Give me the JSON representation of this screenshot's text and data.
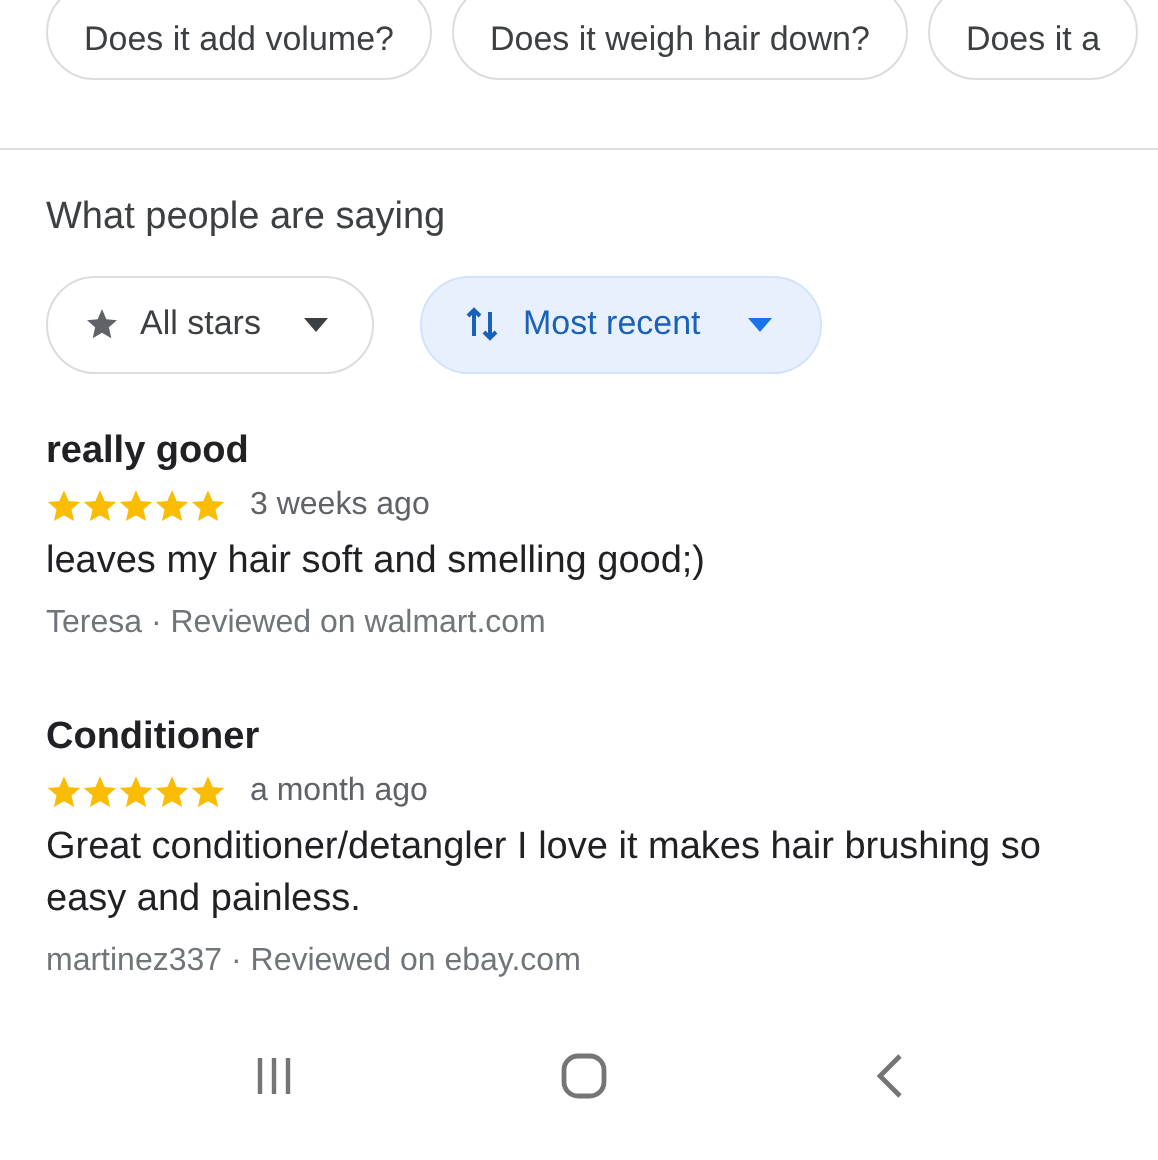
{
  "question_chips": [
    {
      "label": "Does it add volume?"
    },
    {
      "label": "Does it weigh hair down?"
    },
    {
      "label": "Does it a"
    }
  ],
  "reviews_section": {
    "heading": "What people are saying",
    "filters": [
      {
        "kind": "rating",
        "label": "All stars",
        "selected": false
      },
      {
        "kind": "sort",
        "label": "Most recent",
        "selected": true
      }
    ],
    "reviews": [
      {
        "title": "really good",
        "stars": 5,
        "time": "3 weeks ago",
        "text": "leaves my hair soft and smelling good;)",
        "meta": "Teresa · Reviewed on walmart.com"
      },
      {
        "title": "Conditioner",
        "stars": 5,
        "time": "a month ago",
        "text": "Great conditioner/detangler I love it makes hair brushing so easy and painless.",
        "meta": "martinez337 · Reviewed on ebay.com"
      }
    ]
  }
}
